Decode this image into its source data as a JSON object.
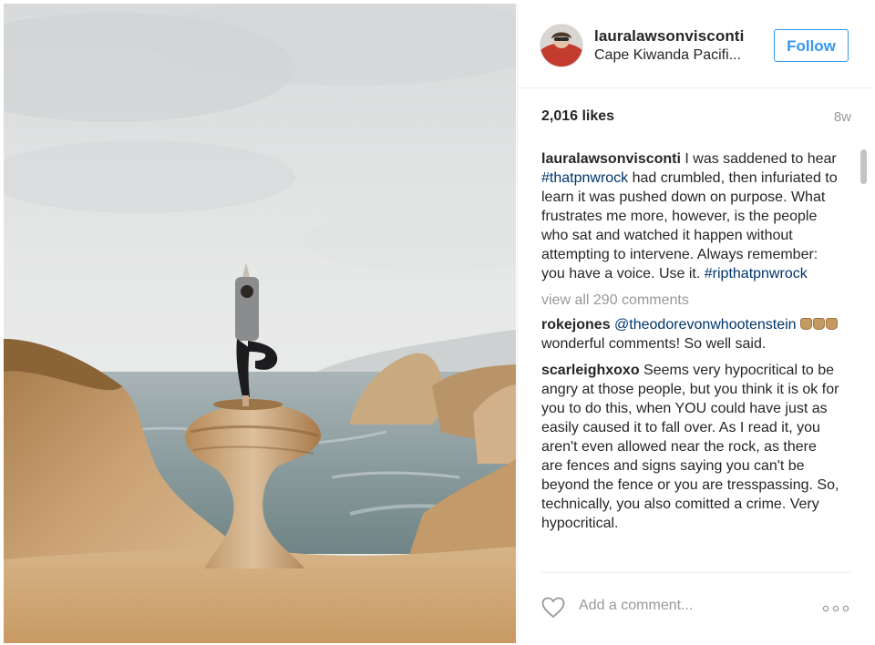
{
  "post": {
    "username": "lauralawsonvisconti",
    "location": "Cape Kiwanda Pacifi...",
    "follow_label": "Follow",
    "likes": "2,016 likes",
    "age": "8w",
    "view_all_comments": "view all 290 comments",
    "add_comment_placeholder": "Add a comment...",
    "caption": {
      "user": "lauralawsonvisconti",
      "text_1": " I was saddened to hear ",
      "hashtag_1": "#thatpnwrock",
      "text_2": " had crumbled, then infuriated to learn it was pushed down on purpose. What frustrates me more, however, is the people who sat and watched it happen without attempting to intervene. Always remember: you have a voice. Use it. ",
      "hashtag_2": "#ripthatpnwrock"
    },
    "comments": [
      {
        "user": "rokejones",
        "mention": "@theodorevonwhootenstein",
        "text": " wonderful comments! So well said."
      },
      {
        "user": "scarleighxoxo",
        "text": " Seems very hypocritical to be angry at those people, but you think it is ok for you to do this, when YOU could have just as easily caused it to fall over. As I read it, you aren't even allowed near the rock, as there are fences and signs saying you can't be beyond the fence or you are tresspassing. So, technically, you also comitted a crime. Very hypocritical."
      }
    ]
  },
  "icons": {
    "like": "heart-outline-icon",
    "more": "more-options-icon",
    "emoji": "thumbs-up-emoji-icon"
  },
  "colors": {
    "accent": "#3897f0",
    "hashtag": "#003569",
    "muted": "#999999",
    "text": "#262626"
  }
}
